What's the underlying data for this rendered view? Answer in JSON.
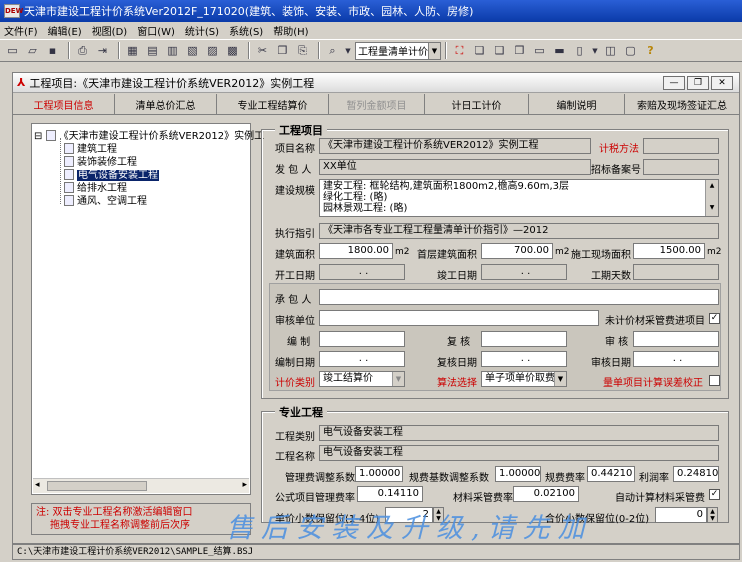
{
  "window": {
    "title": "天津市建设工程计价系统Ver2012F_171020(建筑、装饰、安装、市政、园林、人防、房修)",
    "app_icon_text": "DEW"
  },
  "menu": [
    "文件(F)",
    "编辑(E)",
    "视图(D)",
    "窗口(W)",
    "统计(S)",
    "系统(S)",
    "帮助(H)"
  ],
  "toolbar": {
    "combo_value": "工程量清单计价"
  },
  "child_window": {
    "title": "工程项目:《天津市建设工程计价系统VER2012》实例工程"
  },
  "tabs": [
    {
      "label": "工程项目信息",
      "state": "active"
    },
    {
      "label": "清单总价汇总",
      "state": "normal"
    },
    {
      "label": "专业工程结算价",
      "state": "normal"
    },
    {
      "label": "暂列金额项目",
      "state": "disabled"
    },
    {
      "label": "计日工计价",
      "state": "normal"
    },
    {
      "label": "编制说明",
      "state": "normal"
    },
    {
      "label": "索赔及现场签证汇总",
      "state": "normal"
    }
  ],
  "tree": {
    "root": "《天津市建设工程计价系统VER2012》实例工",
    "root_expander": "⊟",
    "items": [
      "建筑工程",
      "装饰装修工程",
      "电气设备安装工程",
      "给排水工程",
      "通风、空调工程"
    ],
    "selected": 2,
    "scroll_left": "◂",
    "scroll_right": "▸"
  },
  "note": {
    "line1": "注: 双击专业工程名称激活编辑窗口",
    "line2": "拖拽专业工程名称调整前后次序"
  },
  "project": {
    "group_title": "工程项目",
    "name_label": "项目名称",
    "name_value": "《天津市建设工程计价系统VER2012》实例工程",
    "tax_label": "计税方法",
    "tax_value": "",
    "owner_label": "发 包 人",
    "owner_value": "XX单位",
    "bid_label": "招标备案号",
    "bid_value": "",
    "scale_label": "建设规模",
    "scale_lines": [
      "建安工程: 框轮结构,建筑面积1800m2,檐高9.60m,3层",
      "绿化工程: (略)",
      "园林景观工程: (略)"
    ],
    "scroll_up": "▲",
    "scroll_down": "▼",
    "guide_label": "执行指引",
    "guide_value": "《天津市各专业工程工程量清单计价指引》—2012",
    "area_label": "建筑面积",
    "area_value": "1800.00",
    "area_unit": "m2",
    "first_floor_label": "首层建筑面积",
    "first_floor_value": "700.00",
    "first_floor_unit": "m2",
    "site_area_label": "施工现场面积",
    "site_area_value": "1500.00",
    "site_area_unit": "m2",
    "start_label": "开工日期",
    "start_value": " .  . ",
    "finish_label": "竣工日期",
    "finish_value": " .  . ",
    "days_label": "工期天数",
    "days_value": "",
    "contractor_label": "承 包 人",
    "contractor_value": "",
    "audit_unit_label": "审核单位",
    "audit_unit_value": "",
    "material_fee_label": "未计价材采管费进项目",
    "material_fee_checked": "✓",
    "compile_label": "编 制",
    "compile_value": "",
    "review_label": "复 核",
    "review_value": "",
    "approve_label": "审 核",
    "approve_value": "",
    "compile_date_label": "编制日期",
    "compile_date_value": " .  . ",
    "review_date_label": "复核日期",
    "review_date_value": " .  . ",
    "approve_date_label": "审核日期",
    "approve_date_value": " .  . ",
    "pricing_label": "计价类别",
    "pricing_value": "竣工结算价",
    "algo_label": "算法选择",
    "algo_value": "单子项单价取费法",
    "error_label": "量单项目计算误差校正",
    "error_checked": ""
  },
  "specialty": {
    "group_title": "专业工程",
    "type_label": "工程类别",
    "type_value": "电气设备安装工程",
    "name_label": "工程名称",
    "name_value": "电气设备安装工程",
    "mgmt_label": "管理费调整系数",
    "mgmt_value": "1.00000",
    "fee_label": "规费基数调整系数",
    "fee_value": "1.00000",
    "fee_rate_label": "规费费率",
    "fee_rate_value": "0.44210",
    "profit_label": "利润率",
    "profit_value": "0.24810",
    "formula_label": "公式项目管理费率",
    "formula_value": "0.14110",
    "material_label": "材料采管费率",
    "material_value": "0.02100",
    "auto_label": "自动计算材料采管费",
    "auto_checked": "✓",
    "unit_dec_label": "单价小数保留位(1-4位)",
    "unit_dec_value": "2",
    "total_dec_label": "合价小数保留位(0-2位)",
    "total_dec_value": "0"
  },
  "status": {
    "path": "C:\\天津市建设工程计价系统VER2012\\SAMPLE_结算.BSJ"
  },
  "watermark": "售后安装及升级,请先加"
}
